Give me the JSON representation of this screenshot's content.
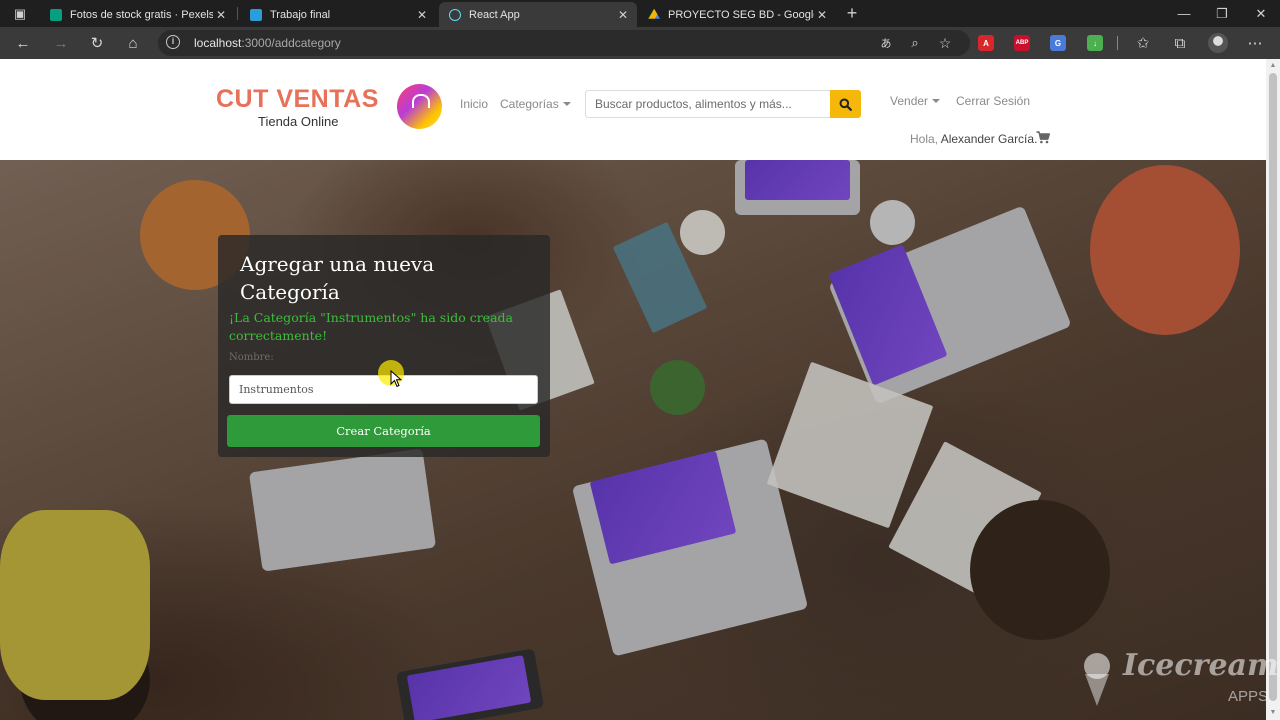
{
  "browser": {
    "tabs": [
      {
        "label": "Fotos de stock gratis · Pexels",
        "favicon_color": "#05a081",
        "active": false
      },
      {
        "label": "Trabajo final",
        "favicon_color": "#2d9cdb",
        "active": false
      },
      {
        "label": "React App",
        "favicon_color": "#61dafb",
        "active": true
      },
      {
        "label": "PROYECTO SEG BD - Google Dri",
        "favicon_color": "#f4b400",
        "active": false
      }
    ],
    "address": {
      "host": "localhost",
      "path": ":3000/addcategory"
    },
    "extension_labels": {
      "abp": "ABP"
    }
  },
  "navbar": {
    "logo": {
      "brand": "CUT VENTAS",
      "tagline": "Tienda Online"
    },
    "links": {
      "home": "Inicio",
      "categories": "Categorías",
      "sell": "Vender",
      "logout": "Cerrar Sesión"
    },
    "search": {
      "placeholder": "Buscar productos, alimentos y más..."
    },
    "greeting": {
      "prefix": "Hola,",
      "user": "Alexander García."
    }
  },
  "form": {
    "title": "Agregar una nueva Categoría",
    "success_message": "¡La Categoría \"Instrumentos\" ha sido creada correctamente!",
    "name_label": "Nombre:",
    "name_value": "Instrumentos",
    "submit_label": "Crear Categoría"
  },
  "watermark": {
    "line1": "Icecream",
    "line2": "APPS"
  },
  "colors": {
    "brand": "#e8715a",
    "search_button": "#f5b80a",
    "success": "#3bbf3b",
    "submit": "#2e9a3a"
  }
}
